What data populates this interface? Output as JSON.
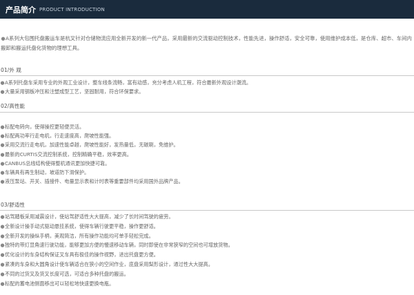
{
  "header": {
    "title_cn": "产品简介",
    "title_en": "PRODUCT INTRODUCTION"
  },
  "intro": "A系列大包围托盘搬运车是杭叉针对仓储物流应用全新开发的新一代产品，采用最新的交流驱动控制技术，性能先进，操作舒适，安全可靠，使用维护成本低，是仓库、超市、车间内搬卸和搬运托盘化货物的理想工具。",
  "bullet": "●",
  "sections": [
    {
      "title": "01/外 观",
      "items": [
        "A系列托盘车采用专业的外观工业设计，整车线条流畅，富有动感，充分考虑人机工程，符合最新外观设计潮流。",
        "大量采用钢板冲压和注塑成型工艺，坚固耐用，符合环保要求。"
      ]
    },
    {
      "title": "02/高性能",
      "items": [
        "标配电转向，使得操控更轻便灵活。",
        "标配两功率行走电机，行走速度高，爬坡性能强。",
        "采用交流行走电机，加速性能卓越，爬坡性能好，发热量低，无碳刷，免维护。",
        "最新的CURTIS交流控制系统，控制精确平稳，效率更高。",
        "CANBUS总线结构使得整机通讯更加快捷可靠。",
        "车辆具有再生制动，坡道防下滑保护。",
        "液压泵站、开关、插接件、电量显示表和计时表等重要部件均采用国外品牌产品。"
      ]
    },
    {
      "title": "03/舒适性",
      "items": [
        "站驾踏板采用减震设计，使站驾舒适性大大提高，减少了长时间驾驶的疲劳。",
        "全新设计操手动式驱动悬挂系统，使得车辆行驶更平稳，操作更舒适。",
        "全新开发的操纵手柄，美观简洁，所有操作功能均可单手轻松完成。",
        "独特的带灯显角速行驶功能，能够更加方便的慢速移动车辆，同时即使在非常狭窄的空间也可增放货物。",
        "优化设计的车身结构保证叉车具有极佳的操作视野，进出托盘更方便。",
        "紧凑的车身和大圆角设计使车辆适合在狭小的空间作业，底盘采用梨形设计，通过性大大提高。",
        "不同的过货叉及货叉长度可选，可适合多种托盘的搬运。",
        "标配的蓄电池侧面移出可以轻松地快速更换电瓶。"
      ]
    }
  ]
}
